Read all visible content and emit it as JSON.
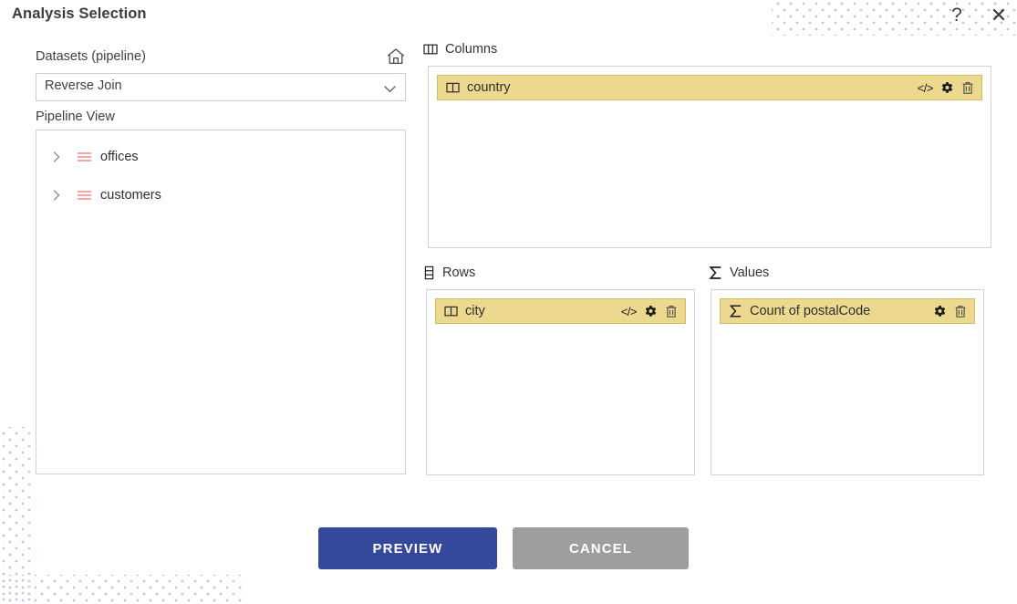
{
  "dialog": {
    "title": "Analysis Selection",
    "help_icon": "question-mark-icon",
    "close_icon": "close-icon"
  },
  "left": {
    "datasets_label": "Datasets (pipeline)",
    "home_icon": "home-icon",
    "dataset_select": {
      "value": "Reverse Join",
      "caret_icon": "chevron-down-icon"
    },
    "pipeline_label": "Pipeline View",
    "tree_items": [
      {
        "label": "offices",
        "expand_icon": "chevron-right-icon",
        "type_icon": "table-lines-icon",
        "expanded": false
      },
      {
        "label": "customers",
        "expand_icon": "chevron-right-icon",
        "type_icon": "table-lines-icon",
        "expanded": false
      }
    ]
  },
  "zones": {
    "columns": {
      "label": "Columns",
      "icon": "columns-icon",
      "chips": [
        {
          "label": "country",
          "icon": "column-field-icon",
          "actions": [
            "code-icon",
            "gear-icon",
            "trash-icon"
          ]
        }
      ]
    },
    "rows": {
      "label": "Rows",
      "icon": "rows-icon",
      "chips": [
        {
          "label": "city",
          "icon": "column-field-icon",
          "actions": [
            "code-icon",
            "gear-icon",
            "trash-icon"
          ]
        }
      ]
    },
    "values": {
      "label": "Values",
      "icon": "sigma-icon",
      "chips": [
        {
          "label": "Count of postalCode",
          "icon": "sigma-icon",
          "actions": [
            "gear-icon",
            "trash-icon"
          ]
        }
      ]
    }
  },
  "footer": {
    "preview_label": "PREVIEW",
    "cancel_label": "CANCEL"
  },
  "colors": {
    "primary": "#34499b",
    "cancel": "#9e9e9e",
    "chip_bg": "#ecd98f",
    "chip_border": "#d4bc63",
    "tree_icon": "#f48a80",
    "dots": "#b9c2e8"
  }
}
